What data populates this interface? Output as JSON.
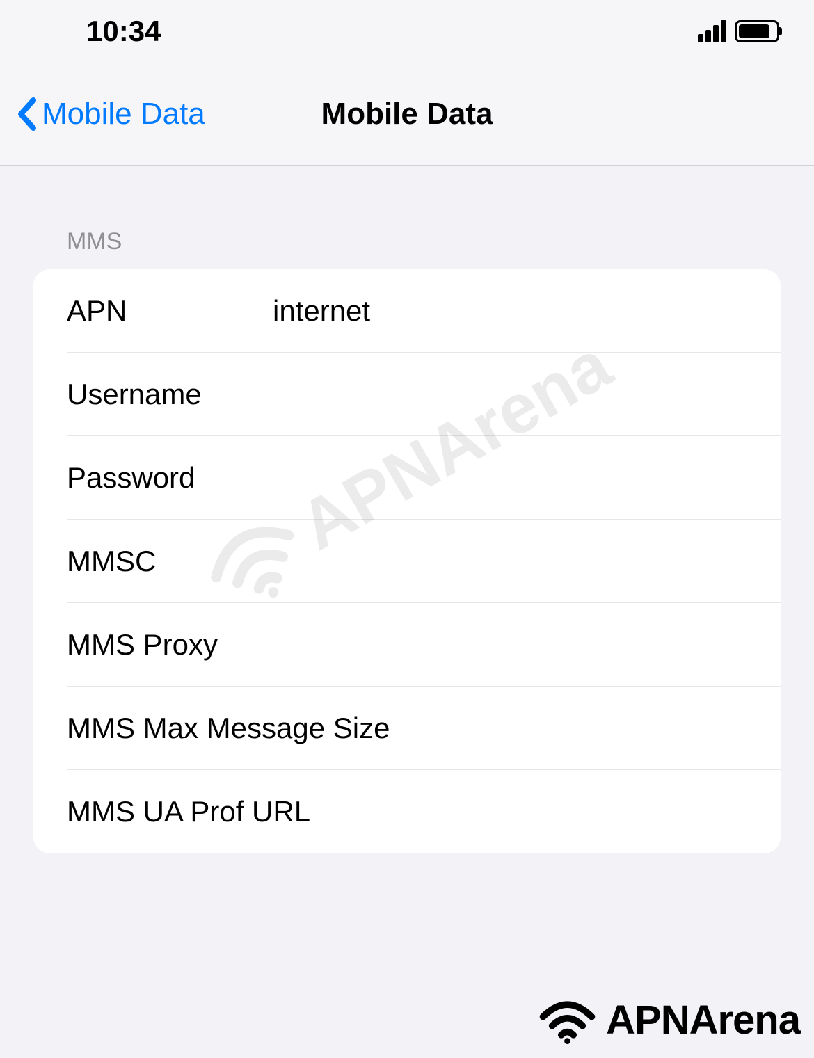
{
  "status_bar": {
    "time": "10:34"
  },
  "nav": {
    "back_label": "Mobile Data",
    "title": "Mobile Data"
  },
  "section": {
    "header": "MMS",
    "rows": [
      {
        "label": "APN",
        "value": "internet"
      },
      {
        "label": "Username",
        "value": ""
      },
      {
        "label": "Password",
        "value": ""
      },
      {
        "label": "MMSC",
        "value": ""
      },
      {
        "label": "MMS Proxy",
        "value": ""
      },
      {
        "label": "MMS Max Message Size",
        "value": ""
      },
      {
        "label": "MMS UA Prof URL",
        "value": ""
      }
    ]
  },
  "watermark": {
    "text": "APNArena"
  }
}
